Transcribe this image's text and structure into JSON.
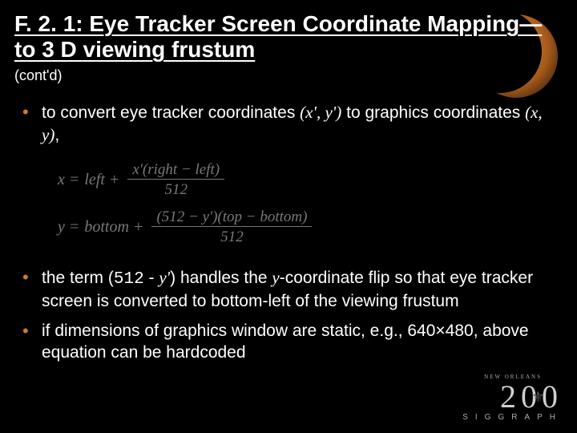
{
  "title": "F. 2. 1: Eye Tracker Screen Coordinate Mapping—to 3 D viewing frustum",
  "subtitle": "(cont'd)",
  "bullets": {
    "b1_pre": "to convert eye tracker coordinates ",
    "b1_coord1": "(x', y')",
    "b1_mid": " to graphics coordinates ",
    "b1_coord2": "(x, y)",
    "b1_post": ",",
    "b2_pre": "the term (",
    "b2_num": "512",
    "b2_mid1": " - ",
    "b2_yprime": "y'",
    "b2_mid2": ") handles the ",
    "b2_yvar": "y",
    "b2_post": "-coordinate flip so that eye tracker screen is converted to bottom-left of the viewing frustum",
    "b3": "if dimensions of graphics window are static, e.g., 640×480, above equation can be hardcoded"
  },
  "equations": {
    "eq1_lhs": "x =",
    "eq1_base": "left +",
    "eq1_num": "x'(right − left)",
    "eq1_den": "512",
    "eq2_lhs": "y =",
    "eq2_base": "bottom +",
    "eq2_num": "(512 − y')(top − bottom)",
    "eq2_den": "512"
  },
  "footer": {
    "neworleans": "NEW ORLEANS",
    "year": "200",
    "siggraph": "SIGGRAPH"
  }
}
